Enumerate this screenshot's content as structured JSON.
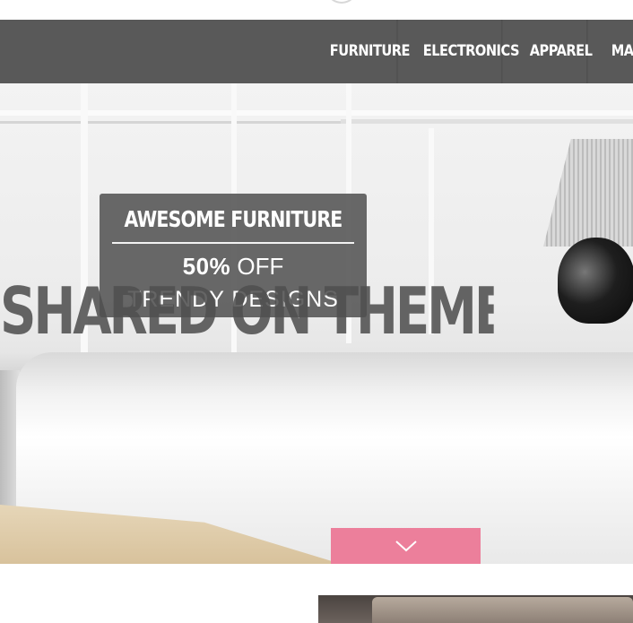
{
  "nav": {
    "items": [
      "FURNITURE",
      "ELECTRONICS",
      "APPAREL",
      "MASTERS"
    ]
  },
  "hero": {
    "caption": {
      "title": "AWESOME FURNITURE",
      "offer_strong": "50%",
      "offer_rest": " OFF",
      "subtitle": "TRENDY DESIGNS"
    },
    "watermark": "SHARED ON THEMELOCK.COM",
    "scroll_icon": "chevron-down-icon"
  },
  "colors": {
    "nav_bg": "#595959",
    "accent_pink": "#ec7f9b",
    "caption_bg": "#505050"
  }
}
